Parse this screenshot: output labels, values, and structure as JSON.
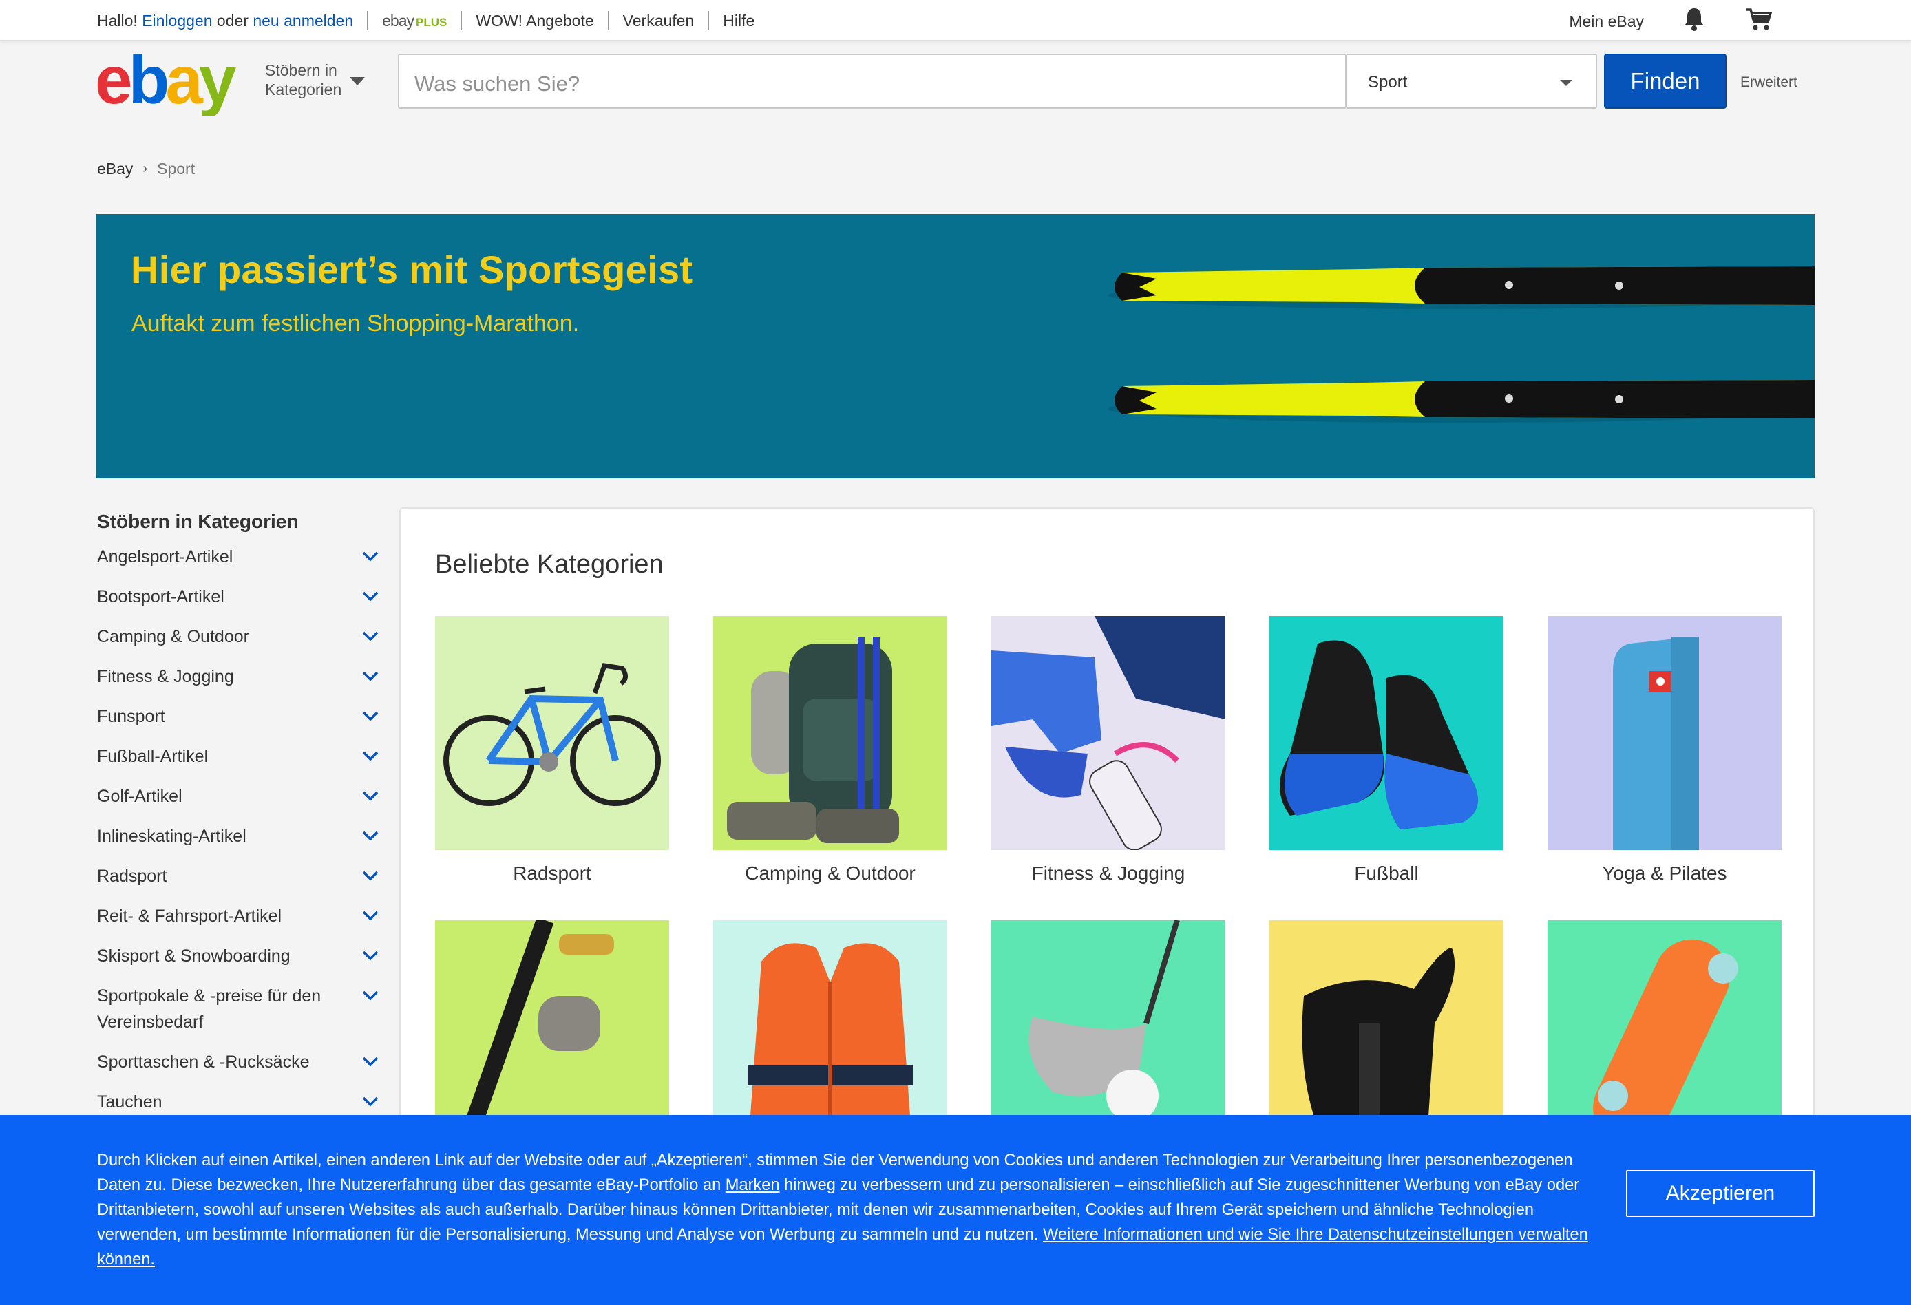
{
  "topbar": {
    "greeting": "Hallo!",
    "signin": "Einloggen",
    "or": "oder",
    "register": "neu anmelden",
    "plus_brand": "ebay",
    "plus_tag": "PLUS",
    "deals": "WOW! Angebote",
    "sell": "Verkaufen",
    "help": "Hilfe",
    "my_ebay": "Mein eBay"
  },
  "header": {
    "browse_line1": "Stöbern in",
    "browse_line2": "Kategorien",
    "search_placeholder": "Was suchen Sie?",
    "category_value": "Sport",
    "find_label": "Finden",
    "advanced_label": "Erweitert"
  },
  "breadcrumb": {
    "root": "eBay",
    "current": "Sport"
  },
  "hero": {
    "title": "Hier passiert’s mit Sportsgeist",
    "subtitle": "Auftakt zum festlichen Shopping-Marathon."
  },
  "sidebar": {
    "title": "Stöbern in Kategorien",
    "items": [
      {
        "label": "Angelsport-Artikel"
      },
      {
        "label": "Bootsport-Artikel"
      },
      {
        "label": "Camping & Outdoor"
      },
      {
        "label": "Fitness & Jogging"
      },
      {
        "label": "Funsport"
      },
      {
        "label": "Fußball-Artikel"
      },
      {
        "label": "Golf-Artikel"
      },
      {
        "label": "Inlineskating-Artikel"
      },
      {
        "label": "Radsport"
      },
      {
        "label": "Reit- & Fahrsport-Artikel"
      },
      {
        "label": "Skisport & Snowboarding"
      },
      {
        "label": "Sportpokale & -preise für den Vereinsbedarf"
      },
      {
        "label": "Sporttaschen & -Rucksäcke"
      },
      {
        "label": "Tauchen"
      }
    ]
  },
  "main": {
    "title": "Beliebte Kategorien",
    "cards": [
      {
        "label": "Radsport",
        "bg": "#d9f2b6"
      },
      {
        "label": "Camping & Outdoor",
        "bg": "#c8ec6b"
      },
      {
        "label": "Fitness & Jogging",
        "bg": "#e7e2f2"
      },
      {
        "label": "Fußball",
        "bg": "#18cfc6"
      },
      {
        "label": "Yoga & Pilates",
        "bg": "#c9c8f2"
      },
      {
        "label": "",
        "bg": "#c8ec6b"
      },
      {
        "label": "",
        "bg": "#c9f4ec"
      },
      {
        "label": "",
        "bg": "#5ee6b2"
      },
      {
        "label": "",
        "bg": "#f7e26b"
      },
      {
        "label": "",
        "bg": "#5fe8ad"
      }
    ]
  },
  "cookie": {
    "text_part1": "Durch Klicken auf einen Artikel, einen anderen Link auf der Website oder auf „Akzeptieren“, stimmen Sie der Verwendung von Cookies und anderen Technologien zur Verarbeitung Ihrer personenbezogenen Daten zu. Diese bezwecken, Ihre Nutzererfahrung über das gesamte eBay-Portfolio an",
    "brands_link": "Marken",
    "text_part2": "hinweg zu verbessern und zu personalisieren – einschließlich auf Sie zugeschnittener Werbung von eBay oder Drittanbietern, sowohl auf unseren Websites als auch außerhalb. Darüber hinaus können Drittanbieter, mit denen wir zusammenarbeiten, Cookies auf Ihrem Gerät speichern und ähnliche Technologien verwenden, um bestimmte Informationen für die Personalisierung, Messung und Analyse von Werbung zu sammeln und zu nutzen.",
    "privacy_link": "Weitere Informationen und wie Sie Ihre Datenschutzeinstellungen verwalten können.",
    "accept_label": "Akzeptieren"
  },
  "colors": {
    "ebay_blue": "#0654ba",
    "hero_bg": "#06708e",
    "hero_text": "#f2cd1b",
    "cookie_bg": "#0a63f5"
  }
}
